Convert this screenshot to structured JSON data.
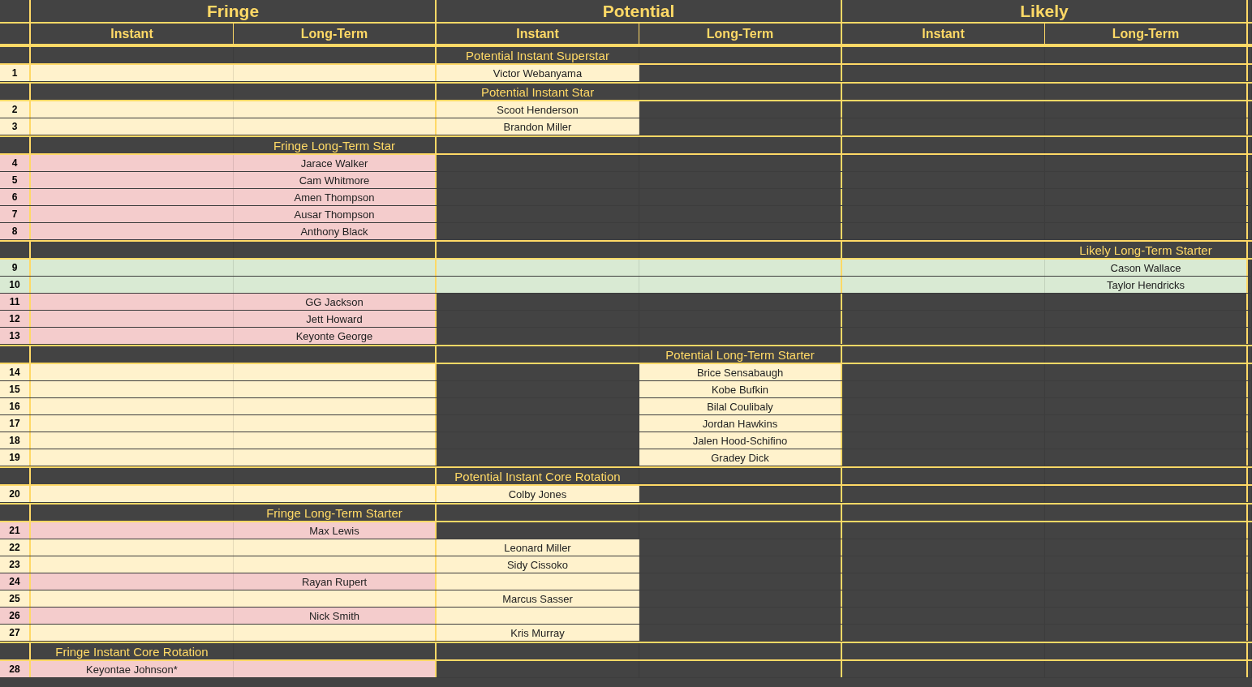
{
  "groups": [
    "Fringe",
    "Potential",
    "Likely"
  ],
  "columns": [
    "Instant",
    "Long-Term",
    "Instant",
    "Long-Term",
    "Instant",
    "Long-Term"
  ],
  "rows": [
    {
      "kind": "section",
      "cells": [
        {
          "color": "#434343"
        },
        {
          "color": "#434343"
        },
        {
          "color": "#434343",
          "text": "Potential Instant Superstar"
        },
        {
          "color": "#434343"
        },
        {
          "color": "#434343"
        },
        {
          "color": "#434343"
        }
      ]
    },
    {
      "kind": "player",
      "number": "1",
      "cells": [
        {
          "color": "#fff2cc"
        },
        {
          "color": "#fff2cc"
        },
        {
          "color": "#fff2cc",
          "text": "Victor Webanyama"
        },
        {
          "color": "#434343"
        },
        {
          "color": "#434343"
        },
        {
          "color": "#434343"
        }
      ]
    },
    {
      "kind": "section",
      "cells": [
        {
          "color": "#434343"
        },
        {
          "color": "#434343"
        },
        {
          "color": "#434343",
          "text": "Potential Instant Star"
        },
        {
          "color": "#434343"
        },
        {
          "color": "#434343"
        },
        {
          "color": "#434343"
        }
      ]
    },
    {
      "kind": "player",
      "number": "2",
      "cells": [
        {
          "color": "#fff2cc"
        },
        {
          "color": "#fff2cc"
        },
        {
          "color": "#fff2cc",
          "text": "Scoot Henderson"
        },
        {
          "color": "#434343"
        },
        {
          "color": "#434343"
        },
        {
          "color": "#434343"
        }
      ]
    },
    {
      "kind": "player",
      "number": "3",
      "cells": [
        {
          "color": "#fff2cc"
        },
        {
          "color": "#fff2cc"
        },
        {
          "color": "#fff2cc",
          "text": "Brandon Miller"
        },
        {
          "color": "#434343"
        },
        {
          "color": "#434343"
        },
        {
          "color": "#434343"
        }
      ]
    },
    {
      "kind": "section",
      "cells": [
        {
          "color": "#434343"
        },
        {
          "color": "#434343",
          "text": "Fringe Long-Term Star"
        },
        {
          "color": "#434343"
        },
        {
          "color": "#434343"
        },
        {
          "color": "#434343"
        },
        {
          "color": "#434343"
        }
      ]
    },
    {
      "kind": "player",
      "number": "4",
      "cells": [
        {
          "color": "#f4cccc"
        },
        {
          "color": "#f4cccc",
          "text": "Jarace Walker"
        },
        {
          "color": "#434343"
        },
        {
          "color": "#434343"
        },
        {
          "color": "#434343"
        },
        {
          "color": "#434343"
        }
      ]
    },
    {
      "kind": "player",
      "number": "5",
      "cells": [
        {
          "color": "#f4cccc"
        },
        {
          "color": "#f4cccc",
          "text": "Cam Whitmore"
        },
        {
          "color": "#434343"
        },
        {
          "color": "#434343"
        },
        {
          "color": "#434343"
        },
        {
          "color": "#434343"
        }
      ]
    },
    {
      "kind": "player",
      "number": "6",
      "cells": [
        {
          "color": "#f4cccc"
        },
        {
          "color": "#f4cccc",
          "text": "Amen Thompson"
        },
        {
          "color": "#434343"
        },
        {
          "color": "#434343"
        },
        {
          "color": "#434343"
        },
        {
          "color": "#434343"
        }
      ]
    },
    {
      "kind": "player",
      "number": "7",
      "cells": [
        {
          "color": "#f4cccc"
        },
        {
          "color": "#f4cccc",
          "text": "Ausar Thompson"
        },
        {
          "color": "#434343"
        },
        {
          "color": "#434343"
        },
        {
          "color": "#434343"
        },
        {
          "color": "#434343"
        }
      ]
    },
    {
      "kind": "player",
      "number": "8",
      "cells": [
        {
          "color": "#f4cccc"
        },
        {
          "color": "#f4cccc",
          "text": "Anthony Black"
        },
        {
          "color": "#434343"
        },
        {
          "color": "#434343"
        },
        {
          "color": "#434343"
        },
        {
          "color": "#434343"
        }
      ]
    },
    {
      "kind": "section",
      "cells": [
        {
          "color": "#434343"
        },
        {
          "color": "#434343"
        },
        {
          "color": "#434343"
        },
        {
          "color": "#434343"
        },
        {
          "color": "#434343"
        },
        {
          "color": "#434343",
          "text": "Likely Long-Term Starter"
        }
      ]
    },
    {
      "kind": "player",
      "number": "9",
      "cells": [
        {
          "color": "#d9ead3"
        },
        {
          "color": "#d9ead3"
        },
        {
          "color": "#d9ead3"
        },
        {
          "color": "#d9ead3"
        },
        {
          "color": "#d9ead3"
        },
        {
          "color": "#d9ead3",
          "text": "Cason Wallace"
        }
      ]
    },
    {
      "kind": "player",
      "number": "10",
      "cells": [
        {
          "color": "#d9ead3"
        },
        {
          "color": "#d9ead3"
        },
        {
          "color": "#d9ead3"
        },
        {
          "color": "#d9ead3"
        },
        {
          "color": "#d9ead3"
        },
        {
          "color": "#d9ead3",
          "text": "Taylor Hendricks"
        }
      ]
    },
    {
      "kind": "player",
      "number": "11",
      "cells": [
        {
          "color": "#f4cccc"
        },
        {
          "color": "#f4cccc",
          "text": "GG Jackson"
        },
        {
          "color": "#434343"
        },
        {
          "color": "#434343"
        },
        {
          "color": "#434343"
        },
        {
          "color": "#434343"
        }
      ]
    },
    {
      "kind": "player",
      "number": "12",
      "cells": [
        {
          "color": "#f4cccc"
        },
        {
          "color": "#f4cccc",
          "text": "Jett Howard"
        },
        {
          "color": "#434343"
        },
        {
          "color": "#434343"
        },
        {
          "color": "#434343"
        },
        {
          "color": "#434343"
        }
      ]
    },
    {
      "kind": "player",
      "number": "13",
      "cells": [
        {
          "color": "#f4cccc"
        },
        {
          "color": "#f4cccc",
          "text": "Keyonte George"
        },
        {
          "color": "#434343"
        },
        {
          "color": "#434343"
        },
        {
          "color": "#434343"
        },
        {
          "color": "#434343"
        }
      ]
    },
    {
      "kind": "section",
      "cells": [
        {
          "color": "#434343"
        },
        {
          "color": "#434343"
        },
        {
          "color": "#434343"
        },
        {
          "color": "#434343",
          "text": "Potential Long-Term Starter"
        },
        {
          "color": "#434343"
        },
        {
          "color": "#434343"
        }
      ]
    },
    {
      "kind": "player",
      "number": "14",
      "cells": [
        {
          "color": "#fff2cc"
        },
        {
          "color": "#fff2cc"
        },
        {
          "color": "#434343"
        },
        {
          "color": "#fff2cc",
          "text": "Brice Sensabaugh"
        },
        {
          "color": "#434343"
        },
        {
          "color": "#434343"
        }
      ]
    },
    {
      "kind": "player",
      "number": "15",
      "cells": [
        {
          "color": "#fff2cc"
        },
        {
          "color": "#fff2cc"
        },
        {
          "color": "#434343"
        },
        {
          "color": "#fff2cc",
          "text": "Kobe Bufkin"
        },
        {
          "color": "#434343"
        },
        {
          "color": "#434343"
        }
      ]
    },
    {
      "kind": "player",
      "number": "16",
      "cells": [
        {
          "color": "#fff2cc"
        },
        {
          "color": "#fff2cc"
        },
        {
          "color": "#434343"
        },
        {
          "color": "#fff2cc",
          "text": "Bilal Coulibaly"
        },
        {
          "color": "#434343"
        },
        {
          "color": "#434343"
        }
      ]
    },
    {
      "kind": "player",
      "number": "17",
      "cells": [
        {
          "color": "#fff2cc"
        },
        {
          "color": "#fff2cc"
        },
        {
          "color": "#434343"
        },
        {
          "color": "#fff2cc",
          "text": "Jordan Hawkins"
        },
        {
          "color": "#434343"
        },
        {
          "color": "#434343"
        }
      ]
    },
    {
      "kind": "player",
      "number": "18",
      "cells": [
        {
          "color": "#fff2cc"
        },
        {
          "color": "#fff2cc"
        },
        {
          "color": "#434343"
        },
        {
          "color": "#fff2cc",
          "text": "Jalen Hood-Schifino"
        },
        {
          "color": "#434343"
        },
        {
          "color": "#434343"
        }
      ]
    },
    {
      "kind": "player",
      "number": "19",
      "cells": [
        {
          "color": "#fff2cc"
        },
        {
          "color": "#fff2cc"
        },
        {
          "color": "#434343"
        },
        {
          "color": "#fff2cc",
          "text": "Gradey Dick"
        },
        {
          "color": "#434343"
        },
        {
          "color": "#434343"
        }
      ]
    },
    {
      "kind": "section",
      "cells": [
        {
          "color": "#434343"
        },
        {
          "color": "#434343"
        },
        {
          "color": "#434343",
          "text": "Potential Instant Core Rotation"
        },
        {
          "color": "#434343"
        },
        {
          "color": "#434343"
        },
        {
          "color": "#434343"
        }
      ]
    },
    {
      "kind": "player",
      "number": "20",
      "cells": [
        {
          "color": "#fff2cc"
        },
        {
          "color": "#fff2cc"
        },
        {
          "color": "#fff2cc",
          "text": "Colby Jones"
        },
        {
          "color": "#434343"
        },
        {
          "color": "#434343"
        },
        {
          "color": "#434343"
        }
      ]
    },
    {
      "kind": "section",
      "cells": [
        {
          "color": "#434343"
        },
        {
          "color": "#434343",
          "text": "Fringe Long-Term Starter"
        },
        {
          "color": "#434343"
        },
        {
          "color": "#434343"
        },
        {
          "color": "#434343"
        },
        {
          "color": "#434343"
        }
      ]
    },
    {
      "kind": "player",
      "number": "21",
      "cells": [
        {
          "color": "#f4cccc"
        },
        {
          "color": "#f4cccc",
          "text": "Max Lewis"
        },
        {
          "color": "#434343"
        },
        {
          "color": "#434343"
        },
        {
          "color": "#434343"
        },
        {
          "color": "#434343"
        }
      ]
    },
    {
      "kind": "player",
      "number": "22",
      "cells": [
        {
          "color": "#fff2cc"
        },
        {
          "color": "#fff2cc"
        },
        {
          "color": "#fff2cc",
          "text": "Leonard Miller"
        },
        {
          "color": "#434343"
        },
        {
          "color": "#434343"
        },
        {
          "color": "#434343"
        }
      ]
    },
    {
      "kind": "player",
      "number": "23",
      "cells": [
        {
          "color": "#fff2cc"
        },
        {
          "color": "#fff2cc"
        },
        {
          "color": "#fff2cc",
          "text": "Sidy Cissoko"
        },
        {
          "color": "#434343"
        },
        {
          "color": "#434343"
        },
        {
          "color": "#434343"
        }
      ]
    },
    {
      "kind": "player",
      "number": "24",
      "cells": [
        {
          "color": "#f4cccc"
        },
        {
          "color": "#f4cccc",
          "text": "Rayan Rupert"
        },
        {
          "color": "#fff2cc"
        },
        {
          "color": "#434343"
        },
        {
          "color": "#434343"
        },
        {
          "color": "#434343"
        }
      ]
    },
    {
      "kind": "player",
      "number": "25",
      "cells": [
        {
          "color": "#fff2cc"
        },
        {
          "color": "#fff2cc"
        },
        {
          "color": "#fff2cc",
          "text": "Marcus Sasser"
        },
        {
          "color": "#434343"
        },
        {
          "color": "#434343"
        },
        {
          "color": "#434343"
        }
      ]
    },
    {
      "kind": "player",
      "number": "26",
      "cells": [
        {
          "color": "#f4cccc"
        },
        {
          "color": "#f4cccc",
          "text": "Nick Smith"
        },
        {
          "color": "#fff2cc"
        },
        {
          "color": "#434343"
        },
        {
          "color": "#434343"
        },
        {
          "color": "#434343"
        }
      ]
    },
    {
      "kind": "player",
      "number": "27",
      "cells": [
        {
          "color": "#fff2cc"
        },
        {
          "color": "#fff2cc"
        },
        {
          "color": "#fff2cc",
          "text": "Kris Murray"
        },
        {
          "color": "#434343"
        },
        {
          "color": "#434343"
        },
        {
          "color": "#434343"
        }
      ]
    },
    {
      "kind": "section",
      "cells": [
        {
          "color": "#434343",
          "text": "Fringe Instant Core Rotation"
        },
        {
          "color": "#434343"
        },
        {
          "color": "#434343"
        },
        {
          "color": "#434343"
        },
        {
          "color": "#434343"
        },
        {
          "color": "#434343"
        }
      ]
    },
    {
      "kind": "player",
      "number": "28",
      "cells": [
        {
          "color": "#f4cccc",
          "text": "Keyontae Johnson*"
        },
        {
          "color": "#f4cccc"
        },
        {
          "color": "#434343"
        },
        {
          "color": "#434343"
        },
        {
          "color": "#434343"
        },
        {
          "color": "#434343"
        }
      ]
    }
  ]
}
